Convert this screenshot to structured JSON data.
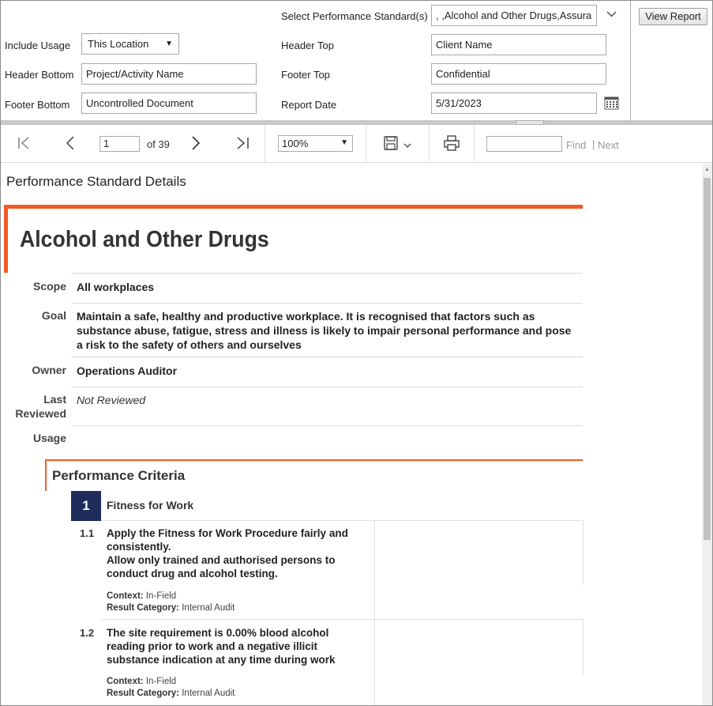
{
  "params": {
    "include_usage": {
      "label": "Include Usage",
      "value": "This Location"
    },
    "header_bottom": {
      "label": "Header Bottom",
      "value": "Project/Activity Name"
    },
    "footer_bottom": {
      "label": "Footer Bottom",
      "value": "Uncontrolled Document"
    },
    "perf_standards": {
      "label": "Select Performance Standard(s)",
      "value": ", ,Alcohol and Other Drugs,Assura"
    },
    "header_top": {
      "label": "Header Top",
      "value": "Client Name"
    },
    "footer_top": {
      "label": "Footer Top",
      "value": "Confidential"
    },
    "report_date": {
      "label": "Report Date",
      "value": "5/31/2023"
    },
    "view_report": "View Report"
  },
  "toolbar": {
    "page_value": "1",
    "of_pages": "of 39",
    "zoom": "100%",
    "find_label": "Find",
    "separator": "|",
    "next_label": "Next"
  },
  "report": {
    "page_title": "Performance Standard Details",
    "standard_title": "Alcohol and Other Drugs",
    "fields": {
      "scope_label": "Scope",
      "scope_value": "All workplaces",
      "goal_label": "Goal",
      "goal_value": "Maintain a safe, healthy and productive workplace. It is recognised that factors such as substance abuse, fatigue, stress and illness is likely to impair personal performance and pose a risk to the safety of others and ourselves",
      "owner_label": "Owner",
      "owner_value": "Operations Auditor",
      "last_reviewed_label_1": "Last",
      "last_reviewed_label_2": "Reviewed",
      "last_reviewed_value": "Not Reviewed",
      "usage_label": "Usage"
    },
    "criteria_heading": "Performance Criteria",
    "category": {
      "number": "1",
      "title": "Fitness for Work"
    },
    "items": [
      {
        "num": "1.1",
        "lines": [
          "Apply the Fitness for Work Procedure fairly and consistently.",
          "Allow only trained and authorised persons to conduct drug and alcohol testing."
        ],
        "context_label": "Context:",
        "context_value": "In-Field",
        "result_label": "Result Category:",
        "result_value": "Internal Audit"
      },
      {
        "num": "1.2",
        "lines": [
          "The site requirement is 0.00% blood alcohol reading prior to work and a negative illicit substance indication at any time during work"
        ],
        "context_label": "Context:",
        "context_value": "In-Field",
        "result_label": "Result Category:",
        "result_value": "Internal Audit"
      }
    ]
  },
  "colors": {
    "accent": "#f15a24",
    "number_bg": "#1f2d5c"
  }
}
